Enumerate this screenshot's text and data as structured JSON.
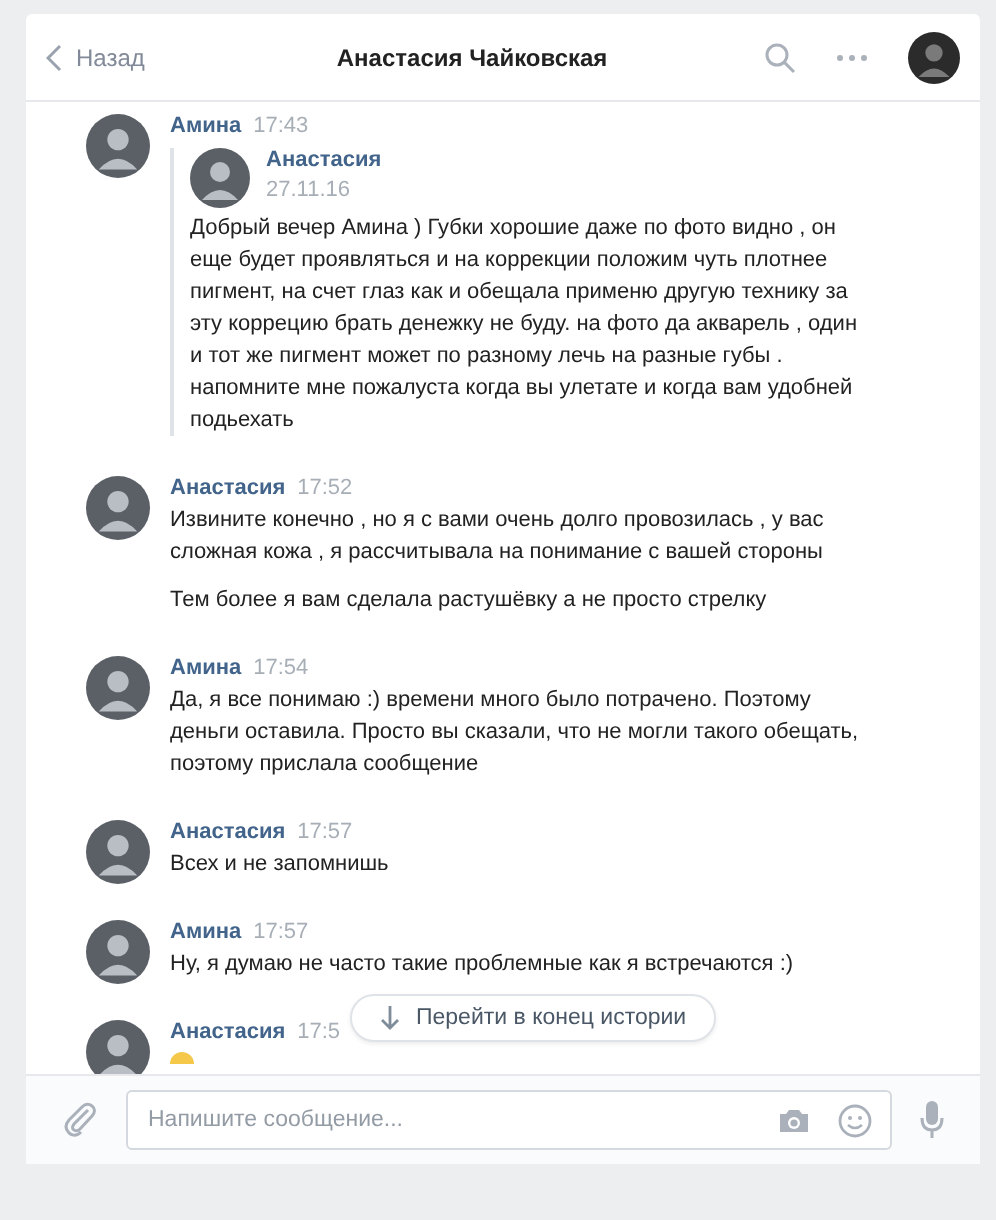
{
  "header": {
    "back": "Назад",
    "title": "Анастасия Чайковская"
  },
  "messages": [
    {
      "author": "Амина",
      "time": "17:43",
      "forward": {
        "author": "Анастасия",
        "date": "27.11.16",
        "text": "Добрый вечер Амина ) Губки хорошие даже по фото видно , он еще будет проявляться и на коррекции положим чуть плотнее пигмент, на счет глаз как и обещала применю другую технику за эту коррецию брать денежку не буду. на фото да акварель , один и тот же пигмент может по разному лечь на разные губы . напомните мне пожалуста когда вы улетате и когда вам удобней подьехать"
      }
    },
    {
      "author": "Анастасия",
      "time": "17:52",
      "paragraphs": [
        "Извините конечно , но я с вами очень долго провозилась , у вас сложная кожа , я рассчитывала на понимание с вашей стороны",
        "Тем более я вам сделала растушёвку а не просто стрелку"
      ]
    },
    {
      "author": "Амина",
      "time": "17:54",
      "paragraphs": [
        "Да, я все понимаю :) времени много было потрачено. Поэтому деньги оставила. Просто вы сказали, что не могли такого обещать, поэтому прислала сообщение"
      ]
    },
    {
      "author": "Анастасия",
      "time": "17:57",
      "paragraphs": [
        "Всех и не запомнишь"
      ]
    },
    {
      "author": "Амина",
      "time": "17:57",
      "paragraphs": [
        "Ну, я думаю не часто такие проблемные как я встречаются :)"
      ]
    },
    {
      "author": "Анастасия",
      "time": "17:5",
      "emoji": true
    }
  ],
  "jump_button": "Перейти в конец истории",
  "composer": {
    "placeholder": "Напишите сообщение..."
  }
}
